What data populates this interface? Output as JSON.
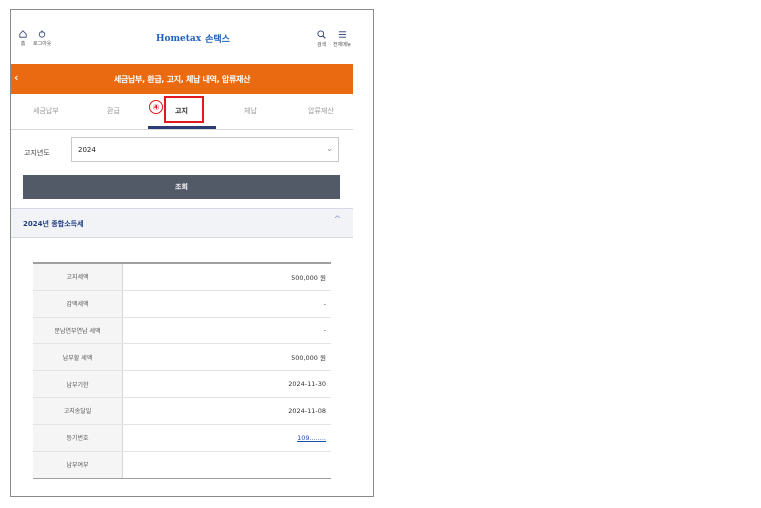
{
  "header": {
    "home_label": "홈",
    "login_label": "로그아웃",
    "logo_text": "손택스",
    "logo_mark": "Hometax",
    "search_label": "검색",
    "menu_label": "전체메뉴"
  },
  "title_bar": {
    "title": "세금납부, 환급, 고지, 체납 내역, 압류재산"
  },
  "tabs": [
    {
      "label": "세금납부"
    },
    {
      "label": "환급"
    },
    {
      "label": "고지"
    },
    {
      "label": "체납"
    },
    {
      "label": "압류재산"
    }
  ],
  "annotation": {
    "step": "④"
  },
  "filter": {
    "year_label": "고지년도",
    "year_value": "2024",
    "search_button": "조회"
  },
  "section": {
    "title": "2024년 종합소득세"
  },
  "details": [
    {
      "label": "고지세액",
      "value": "500,000 원"
    },
    {
      "label": "감액세액",
      "value": "-"
    },
    {
      "label": "분납연부연납 세액",
      "value": "-"
    },
    {
      "label": "납부할 세액",
      "value": "500,000 원"
    },
    {
      "label": "납부기한",
      "value": "2024-11-30"
    },
    {
      "label": "고지송달일",
      "value": "2024-11-08"
    },
    {
      "label": "등기번호",
      "value": "109........"
    },
    {
      "label": "납부여부",
      "value": ""
    }
  ],
  "colors": {
    "title_bar": "#ea6a11",
    "active_tab_underline": "#2c3e75",
    "highlight": "#e0191e",
    "button": "#525a68",
    "link": "#1a4ea8"
  }
}
